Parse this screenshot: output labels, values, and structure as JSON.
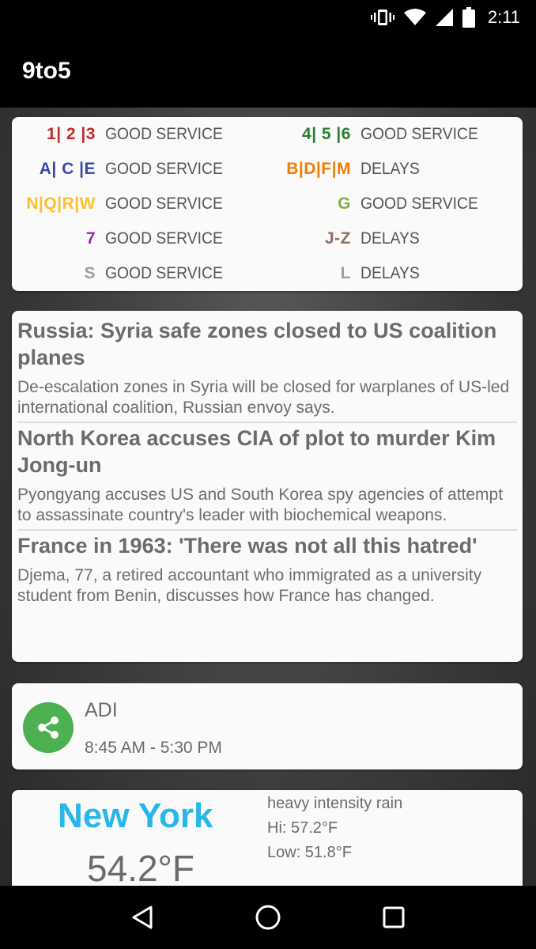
{
  "status_bar": {
    "time": "2:11",
    "icons": [
      "vibrate-icon",
      "wifi-icon",
      "cell-signal-icon",
      "battery-icon"
    ]
  },
  "app_bar": {
    "title": "9to5"
  },
  "subway": {
    "left": [
      {
        "lines": "1| 2 |3",
        "status": "GOOD SERVICE",
        "color": "#c62828"
      },
      {
        "lines": "A| C |E",
        "status": "GOOD SERVICE",
        "color": "#3949ab"
      },
      {
        "lines": "N|Q|R|W",
        "status": "GOOD SERVICE",
        "color": "#fbc02d"
      },
      {
        "lines": "7",
        "status": "GOOD SERVICE",
        "color": "#9c27b0"
      },
      {
        "lines": "S",
        "status": "GOOD SERVICE",
        "color": "#9e9e9e"
      }
    ],
    "right": [
      {
        "lines": "4| 5 |6",
        "status": "GOOD SERVICE",
        "color": "#2e7d32"
      },
      {
        "lines": "B|D|F|M",
        "status": "DELAYS",
        "color": "#f57c00"
      },
      {
        "lines": "G",
        "status": "GOOD SERVICE",
        "color": "#7cb342"
      },
      {
        "lines": "J-Z",
        "status": "DELAYS",
        "color": "#8d6e63"
      },
      {
        "lines": "L",
        "status": "DELAYS",
        "color": "#9e9e9e"
      }
    ]
  },
  "news": [
    {
      "title": "Russia: Syria safe zones closed to US coalition planes",
      "body": "De-escalation zones in Syria will be closed for warplanes of US-led international coalition, Russian envoy says."
    },
    {
      "title": "North Korea accuses CIA of plot to murder Kim Jong-un",
      "body": "Pyongyang accuses US and South Korea spy agencies of attempt to assassinate country's leader with biochemical weapons."
    },
    {
      "title": "France in 1963: 'There was not all this hatred'",
      "body": "Djema, 77, a retired accountant who immigrated as a university student from Benin, discusses how France has changed."
    }
  ],
  "calendar": {
    "name": "ADI",
    "time": "8:45 AM - 5:30 PM",
    "icon": "share-icon",
    "color": "#4caf50"
  },
  "weather": {
    "city": "New York",
    "temperature": "54.2°F",
    "description": "heavy intensity rain",
    "high": "Hi: 57.2°F",
    "low": "Low: 51.8°F",
    "city_color": "#29b6e8"
  },
  "nav_bar": {
    "icons": [
      "back-icon",
      "home-icon",
      "recents-icon"
    ]
  }
}
